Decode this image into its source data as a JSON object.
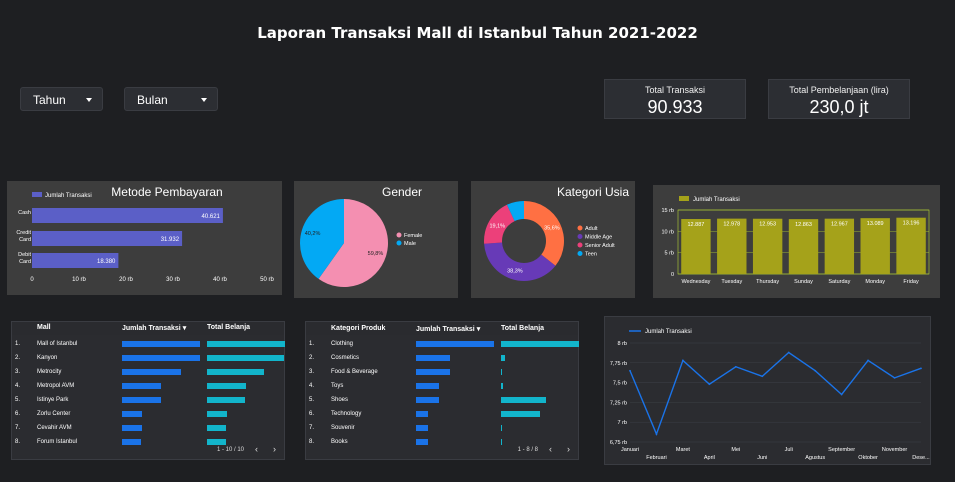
{
  "title": "Laporan Transaksi Mall di Istanbul Tahun 2021-2022",
  "filters": {
    "year_label": "Tahun",
    "month_label": "Bulan"
  },
  "kpis": {
    "total_transaksi_label": "Total Transaksi",
    "total_transaksi_value": "90.933",
    "total_belanja_label": "Total Pembelanjaan (lira)",
    "total_belanja_value": "230,0 jt"
  },
  "colors": {
    "payment_bar": "#5b5fc7",
    "female": "#f48fb1",
    "male": "#03a9f4",
    "adult": "#ff7043",
    "middle_age": "#673ab7",
    "senior_adult": "#ec407a",
    "teen": "#03a9f4",
    "weekday_bar": "#a5a21a",
    "table_blue": "#1a73e8",
    "table_teal": "#12b5cb",
    "line": "#1a73e8"
  },
  "payment_chart": {
    "title": "Metode Pembayaran",
    "legend": "Jumlah Transaksi",
    "categories": [
      "Cash",
      "Credit Card",
      "Debit Card"
    ],
    "values": [
      40621,
      31932,
      18380
    ],
    "labels": [
      "40.621",
      "31.932",
      "18.380"
    ],
    "ticks": [
      "0",
      "10 rb",
      "20 rb",
      "30 rb",
      "40 rb",
      "50 rb"
    ]
  },
  "gender_chart": {
    "title": "Gender",
    "legend": [
      "Female",
      "Male"
    ],
    "values": [
      59.8,
      40.2
    ],
    "labels": [
      "59,8%",
      "40,2%"
    ]
  },
  "age_chart": {
    "title": "Kategori Usia",
    "legend": [
      "Adult",
      "Middle Age",
      "Senior Adult",
      "Teen"
    ],
    "values": [
      35.6,
      38.3,
      19.1,
      7.0
    ],
    "labels": [
      "35,6%",
      "38,3%",
      "19,1%"
    ]
  },
  "weekday_chart": {
    "legend": "Jumlah Transaksi",
    "categories": [
      "Wednesday",
      "Tuesday",
      "Thursday",
      "Sunday",
      "Saturday",
      "Monday",
      "Friday"
    ],
    "values": [
      12887,
      12978,
      12953,
      12863,
      12967,
      13089,
      13196
    ],
    "labels": [
      "12.887",
      "12.978",
      "12.953",
      "12.863",
      "12.967",
      "13.089",
      "13.196"
    ],
    "yticks": [
      "15 rb",
      "10 rb",
      "5 rb",
      "0"
    ]
  },
  "mall_table": {
    "headers": [
      "Mall",
      "Jumlah Transaksi",
      "Total Belanja"
    ],
    "sort_indicator": "▾",
    "rows": [
      {
        "no": "1.",
        "name": "Mall of Istanbul",
        "trx": 1.0,
        "spend": 1.0
      },
      {
        "no": "2.",
        "name": "Kanyon",
        "trx": 1.0,
        "spend": 0.99
      },
      {
        "no": "3.",
        "name": "Metrocity",
        "trx": 0.75,
        "spend": 0.73
      },
      {
        "no": "4.",
        "name": "Metropol AVM",
        "trx": 0.5,
        "spend": 0.5
      },
      {
        "no": "5.",
        "name": "Istinye Park",
        "trx": 0.5,
        "spend": 0.49
      },
      {
        "no": "6.",
        "name": "Zorlu Center",
        "trx": 0.25,
        "spend": 0.25
      },
      {
        "no": "7.",
        "name": "Cevahir AVM",
        "trx": 0.25,
        "spend": 0.24
      },
      {
        "no": "8.",
        "name": "Forum Istanbul",
        "trx": 0.24,
        "spend": 0.24
      }
    ],
    "pager": "1 - 10 / 10"
  },
  "category_table": {
    "headers": [
      "Kategori Produk",
      "Jumlah Transaksi",
      "Total Belanja"
    ],
    "sort_indicator": "▾",
    "rows": [
      {
        "no": "1.",
        "name": "Clothing",
        "trx": 1.0,
        "spend": 1.0
      },
      {
        "no": "2.",
        "name": "Cosmetics",
        "trx": 0.44,
        "spend": 0.05
      },
      {
        "no": "3.",
        "name": "Food & Beverage",
        "trx": 0.44,
        "spend": 0.01
      },
      {
        "no": "4.",
        "name": "Toys",
        "trx": 0.3,
        "spend": 0.03
      },
      {
        "no": "5.",
        "name": "Shoes",
        "trx": 0.3,
        "spend": 0.58
      },
      {
        "no": "6.",
        "name": "Technology",
        "trx": 0.15,
        "spend": 0.5
      },
      {
        "no": "7.",
        "name": "Souvenir",
        "trx": 0.15,
        "spend": 0.01
      },
      {
        "no": "8.",
        "name": "Books",
        "trx": 0.15,
        "spend": 0.01
      }
    ],
    "pager": "1 - 8 / 8"
  },
  "chart_data": {
    "type": "line",
    "legend": "Jumlah Transaksi",
    "x": [
      "Januari",
      "Februari",
      "Maret",
      "April",
      "Mei",
      "Juni",
      "Juli",
      "Agustus",
      "September",
      "Oktober",
      "November",
      "Dese..."
    ],
    "values": [
      7650,
      6850,
      7780,
      7480,
      7700,
      7580,
      7880,
      7650,
      7350,
      7780,
      7560,
      7680
    ],
    "yticks": [
      "8 rb",
      "7,75 rb",
      "7,5 rb",
      "7,25 rb",
      "7 rb",
      "6,75 rb"
    ],
    "ylim": [
      6750,
      8000
    ]
  }
}
